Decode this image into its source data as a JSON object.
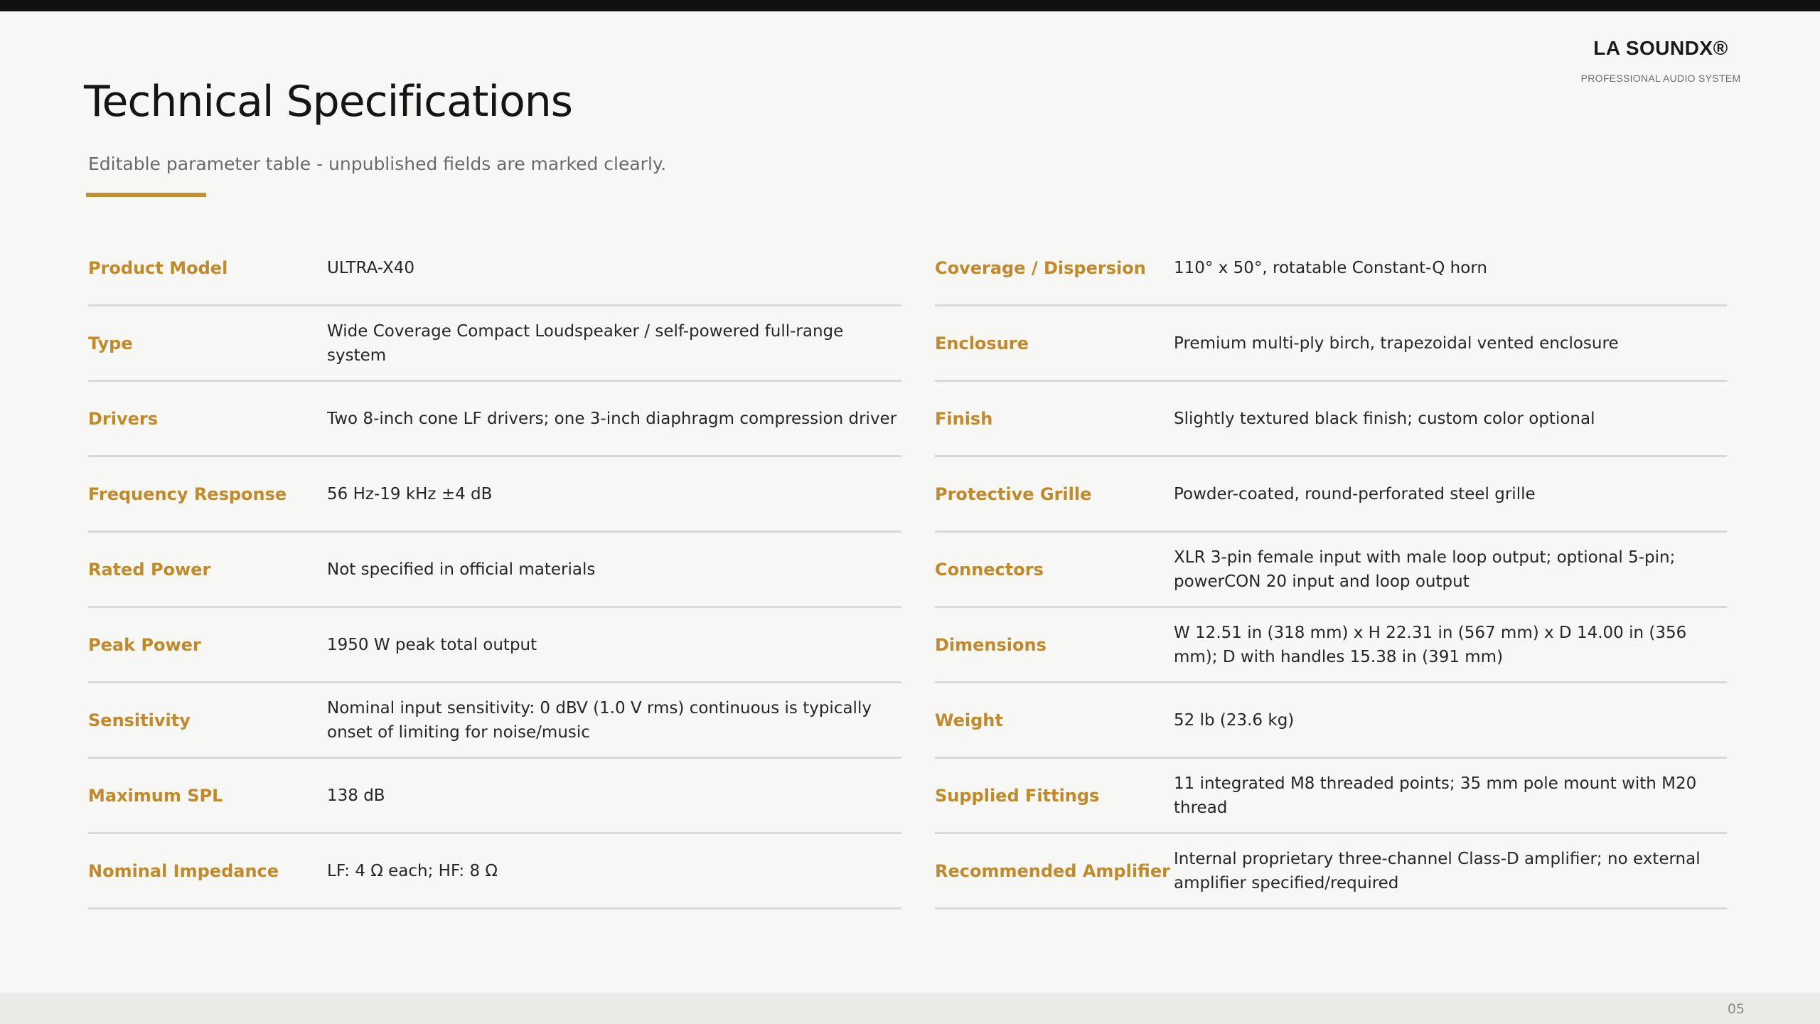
{
  "brand": {
    "name": "LA SOUNDX®",
    "tagline": "PROFESSIONAL AUDIO SYSTEM"
  },
  "header": {
    "title": "Technical Specifications",
    "subtitle": "Editable parameter table - unpublished fields are marked clearly."
  },
  "specs": {
    "left": [
      {
        "label": "Product Model",
        "value": "ULTRA-X40"
      },
      {
        "label": "Type",
        "value": "Wide Coverage Compact Loudspeaker / self-powered full-range system"
      },
      {
        "label": "Drivers",
        "value": "Two 8-inch cone LF drivers; one 3-inch diaphragm compression driver"
      },
      {
        "label": "Frequency Response",
        "value": "56 Hz-19 kHz ±4 dB"
      },
      {
        "label": "Rated Power",
        "value": "Not specified in official materials"
      },
      {
        "label": "Peak Power",
        "value": "1950 W peak total output"
      },
      {
        "label": "Sensitivity",
        "value": "Nominal input sensitivity: 0 dBV (1.0 V rms) continuous is typically onset of limiting for noise/music"
      },
      {
        "label": "Maximum SPL",
        "value": "138 dB"
      },
      {
        "label": "Nominal Impedance",
        "value": "LF: 4 Ω each; HF: 8 Ω"
      }
    ],
    "right": [
      {
        "label": "Coverage / Dispersion",
        "value": "110° x 50°, rotatable Constant-Q horn"
      },
      {
        "label": "Enclosure",
        "value": "Premium multi-ply birch, trapezoidal vented enclosure"
      },
      {
        "label": "Finish",
        "value": "Slightly textured black finish; custom color optional"
      },
      {
        "label": "Protective Grille",
        "value": "Powder-coated, round-perforated steel grille"
      },
      {
        "label": "Connectors",
        "value": "XLR 3-pin female input with male loop output; optional 5-pin; powerCON 20 input and loop output"
      },
      {
        "label": "Dimensions",
        "value": "W 12.51 in (318 mm) x H 22.31 in (567 mm) x D 14.00 in (356 mm); D with handles 15.38 in (391 mm)"
      },
      {
        "label": "Weight",
        "value": "52 lb (23.6 kg)"
      },
      {
        "label": "Supplied Fittings",
        "value": "11 integrated M8 threaded points; 35 mm pole mount with M20 thread"
      },
      {
        "label": "Recommended Amplifier",
        "value": "Internal proprietary three-channel Class-D amplifier; no external amplifier specified/required"
      }
    ]
  },
  "footer": {
    "page_number": "05"
  },
  "colors": {
    "accent": "#c08a2c",
    "top_bar": "#111111",
    "background": "#f7f7f5"
  }
}
